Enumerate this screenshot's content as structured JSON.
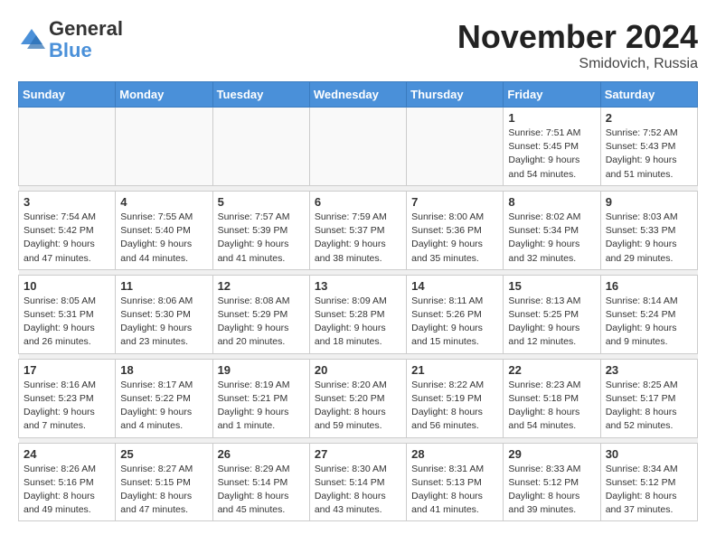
{
  "header": {
    "logo_general": "General",
    "logo_blue": "Blue",
    "month": "November 2024",
    "location": "Smidovich, Russia"
  },
  "days_of_week": [
    "Sunday",
    "Monday",
    "Tuesday",
    "Wednesday",
    "Thursday",
    "Friday",
    "Saturday"
  ],
  "weeks": [
    [
      {
        "day": "",
        "info": ""
      },
      {
        "day": "",
        "info": ""
      },
      {
        "day": "",
        "info": ""
      },
      {
        "day": "",
        "info": ""
      },
      {
        "day": "",
        "info": ""
      },
      {
        "day": "1",
        "info": "Sunrise: 7:51 AM\nSunset: 5:45 PM\nDaylight: 9 hours\nand 54 minutes."
      },
      {
        "day": "2",
        "info": "Sunrise: 7:52 AM\nSunset: 5:43 PM\nDaylight: 9 hours\nand 51 minutes."
      }
    ],
    [
      {
        "day": "3",
        "info": "Sunrise: 7:54 AM\nSunset: 5:42 PM\nDaylight: 9 hours\nand 47 minutes."
      },
      {
        "day": "4",
        "info": "Sunrise: 7:55 AM\nSunset: 5:40 PM\nDaylight: 9 hours\nand 44 minutes."
      },
      {
        "day": "5",
        "info": "Sunrise: 7:57 AM\nSunset: 5:39 PM\nDaylight: 9 hours\nand 41 minutes."
      },
      {
        "day": "6",
        "info": "Sunrise: 7:59 AM\nSunset: 5:37 PM\nDaylight: 9 hours\nand 38 minutes."
      },
      {
        "day": "7",
        "info": "Sunrise: 8:00 AM\nSunset: 5:36 PM\nDaylight: 9 hours\nand 35 minutes."
      },
      {
        "day": "8",
        "info": "Sunrise: 8:02 AM\nSunset: 5:34 PM\nDaylight: 9 hours\nand 32 minutes."
      },
      {
        "day": "9",
        "info": "Sunrise: 8:03 AM\nSunset: 5:33 PM\nDaylight: 9 hours\nand 29 minutes."
      }
    ],
    [
      {
        "day": "10",
        "info": "Sunrise: 8:05 AM\nSunset: 5:31 PM\nDaylight: 9 hours\nand 26 minutes."
      },
      {
        "day": "11",
        "info": "Sunrise: 8:06 AM\nSunset: 5:30 PM\nDaylight: 9 hours\nand 23 minutes."
      },
      {
        "day": "12",
        "info": "Sunrise: 8:08 AM\nSunset: 5:29 PM\nDaylight: 9 hours\nand 20 minutes."
      },
      {
        "day": "13",
        "info": "Sunrise: 8:09 AM\nSunset: 5:28 PM\nDaylight: 9 hours\nand 18 minutes."
      },
      {
        "day": "14",
        "info": "Sunrise: 8:11 AM\nSunset: 5:26 PM\nDaylight: 9 hours\nand 15 minutes."
      },
      {
        "day": "15",
        "info": "Sunrise: 8:13 AM\nSunset: 5:25 PM\nDaylight: 9 hours\nand 12 minutes."
      },
      {
        "day": "16",
        "info": "Sunrise: 8:14 AM\nSunset: 5:24 PM\nDaylight: 9 hours\nand 9 minutes."
      }
    ],
    [
      {
        "day": "17",
        "info": "Sunrise: 8:16 AM\nSunset: 5:23 PM\nDaylight: 9 hours\nand 7 minutes."
      },
      {
        "day": "18",
        "info": "Sunrise: 8:17 AM\nSunset: 5:22 PM\nDaylight: 9 hours\nand 4 minutes."
      },
      {
        "day": "19",
        "info": "Sunrise: 8:19 AM\nSunset: 5:21 PM\nDaylight: 9 hours\nand 1 minute."
      },
      {
        "day": "20",
        "info": "Sunrise: 8:20 AM\nSunset: 5:20 PM\nDaylight: 8 hours\nand 59 minutes."
      },
      {
        "day": "21",
        "info": "Sunrise: 8:22 AM\nSunset: 5:19 PM\nDaylight: 8 hours\nand 56 minutes."
      },
      {
        "day": "22",
        "info": "Sunrise: 8:23 AM\nSunset: 5:18 PM\nDaylight: 8 hours\nand 54 minutes."
      },
      {
        "day": "23",
        "info": "Sunrise: 8:25 AM\nSunset: 5:17 PM\nDaylight: 8 hours\nand 52 minutes."
      }
    ],
    [
      {
        "day": "24",
        "info": "Sunrise: 8:26 AM\nSunset: 5:16 PM\nDaylight: 8 hours\nand 49 minutes."
      },
      {
        "day": "25",
        "info": "Sunrise: 8:27 AM\nSunset: 5:15 PM\nDaylight: 8 hours\nand 47 minutes."
      },
      {
        "day": "26",
        "info": "Sunrise: 8:29 AM\nSunset: 5:14 PM\nDaylight: 8 hours\nand 45 minutes."
      },
      {
        "day": "27",
        "info": "Sunrise: 8:30 AM\nSunset: 5:14 PM\nDaylight: 8 hours\nand 43 minutes."
      },
      {
        "day": "28",
        "info": "Sunrise: 8:31 AM\nSunset: 5:13 PM\nDaylight: 8 hours\nand 41 minutes."
      },
      {
        "day": "29",
        "info": "Sunrise: 8:33 AM\nSunset: 5:12 PM\nDaylight: 8 hours\nand 39 minutes."
      },
      {
        "day": "30",
        "info": "Sunrise: 8:34 AM\nSunset: 5:12 PM\nDaylight: 8 hours\nand 37 minutes."
      }
    ]
  ]
}
